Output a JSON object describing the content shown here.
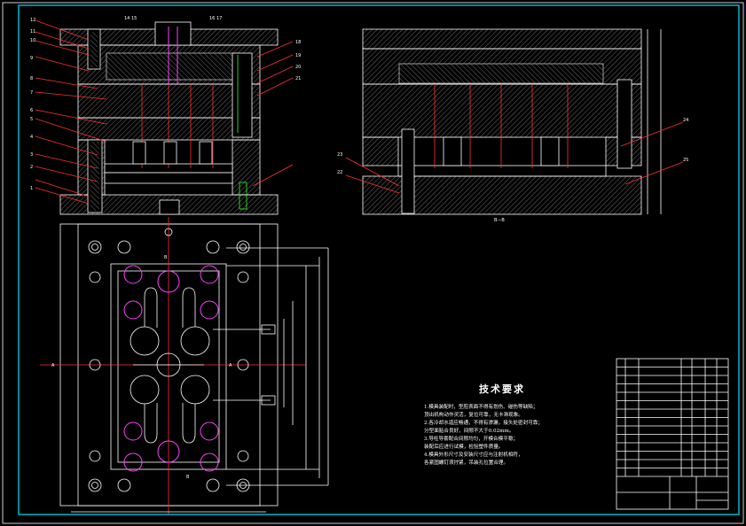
{
  "drawing": {
    "frame_color": "#00e6ff",
    "background": "#000000",
    "line_color": "#ffffff",
    "accent_red": "#ff3030",
    "accent_magenta": "#ff40ff",
    "accent_green": "#30ff30"
  },
  "section_view": {
    "part_numbers_left": [
      "12",
      "11",
      "10",
      "9",
      "8",
      "7",
      "6",
      "5",
      "4",
      "3",
      "2",
      "1"
    ],
    "part_numbers_right": [
      "18",
      "19",
      "20",
      "21"
    ],
    "part_numbers_top": [
      "14 15",
      "16 17"
    ]
  },
  "side_view": {
    "part_numbers_right": [
      "24",
      "25"
    ],
    "part_numbers_left": [
      "23",
      "22"
    ],
    "caption": "B—B"
  },
  "plan_view": {
    "section_marks": [
      "A",
      "A",
      "B",
      "B"
    ]
  },
  "technical_requirements": {
    "title": "技术要求",
    "lines": [
      "1.模具装配时，型腔表面不得有划伤、碰伤等缺陷；",
      "  顶出机构动作灵活，复位可靠，无卡滞现象。",
      "2.各冷却水道应畅通，不得有渗漏，接头处密封可靠；",
      "  分型面贴合良好，间隙不大于0.02mm。",
      "3.导柱导套配合间隙均匀，开模合模平稳；",
      "  装配后应进行试模，检验塑件质量。",
      "4.模具外形尺寸及安装尺寸应与注射机相符，",
      "  各紧固螺钉须拧紧，吊装孔位置合理。"
    ]
  },
  "title_block": {
    "rows": 14
  }
}
